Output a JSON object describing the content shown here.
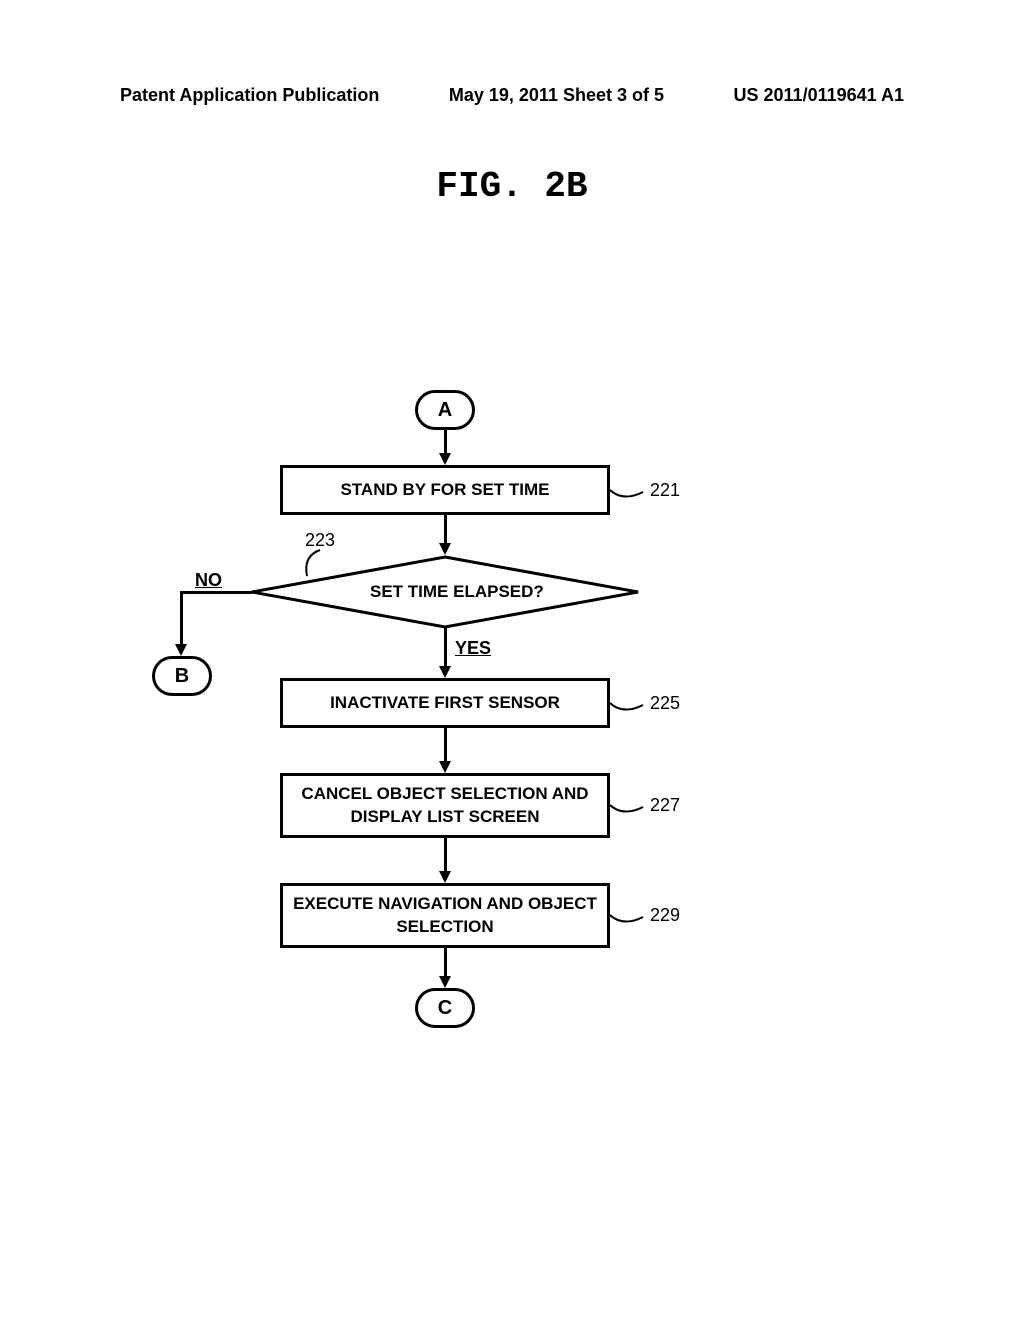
{
  "header": {
    "left": "Patent Application Publication",
    "center": "May 19, 2011  Sheet 3 of 5",
    "right": "US 2011/0119641 A1"
  },
  "figure_title": "FIG. 2B",
  "terminals": {
    "a": "A",
    "b": "B",
    "c": "C"
  },
  "boxes": {
    "step221": "STAND BY FOR SET TIME",
    "step223": "SET TIME ELAPSED?",
    "step225": "INACTIVATE FIRST SENSOR",
    "step227": "CANCEL OBJECT SELECTION AND DISPLAY LIST SCREEN",
    "step229": "EXECUTE NAVIGATION AND OBJECT SELECTION"
  },
  "labels": {
    "ref221": "221",
    "ref223": "223",
    "ref225": "225",
    "ref227": "227",
    "ref229": "229",
    "no": "NO",
    "yes": "YES"
  },
  "chart_data": {
    "type": "flowchart",
    "nodes": [
      {
        "id": "A",
        "type": "connector",
        "label": "A"
      },
      {
        "id": "221",
        "type": "process",
        "label": "STAND BY FOR SET TIME"
      },
      {
        "id": "223",
        "type": "decision",
        "label": "SET TIME ELAPSED?"
      },
      {
        "id": "B",
        "type": "connector",
        "label": "B"
      },
      {
        "id": "225",
        "type": "process",
        "label": "INACTIVATE FIRST SENSOR"
      },
      {
        "id": "227",
        "type": "process",
        "label": "CANCEL OBJECT SELECTION AND DISPLAY LIST SCREEN"
      },
      {
        "id": "229",
        "type": "process",
        "label": "EXECUTE NAVIGATION AND OBJECT SELECTION"
      },
      {
        "id": "C",
        "type": "connector",
        "label": "C"
      }
    ],
    "edges": [
      {
        "from": "A",
        "to": "221"
      },
      {
        "from": "221",
        "to": "223"
      },
      {
        "from": "223",
        "to": "B",
        "label": "NO"
      },
      {
        "from": "223",
        "to": "225",
        "label": "YES"
      },
      {
        "from": "225",
        "to": "227"
      },
      {
        "from": "227",
        "to": "229"
      },
      {
        "from": "229",
        "to": "C"
      }
    ]
  }
}
